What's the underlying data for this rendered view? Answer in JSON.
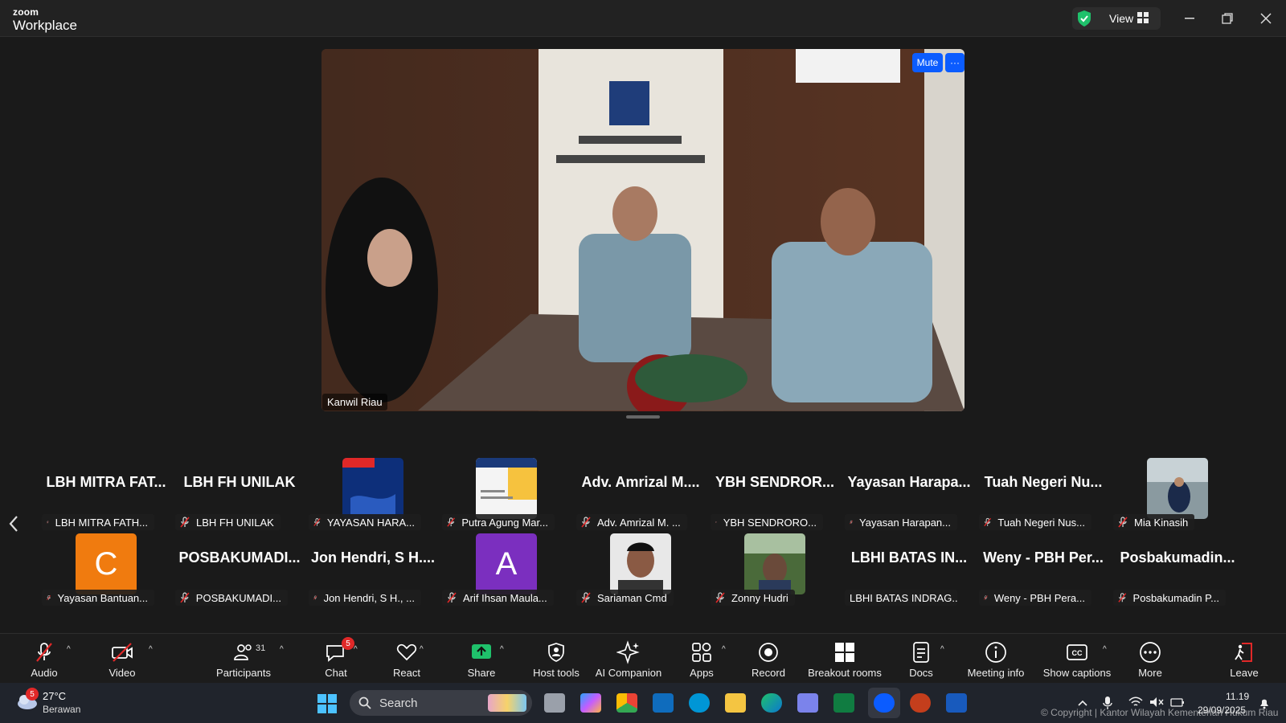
{
  "titlebar": {
    "brand_small": "zoom",
    "brand_big": "Workplace",
    "view_label": "View"
  },
  "meeting": {
    "speaker_name": "Kanwil Riau",
    "mute_label": "Mute",
    "more_label": "···"
  },
  "gallery": {
    "row1": [
      {
        "big": "LBH MITRA FAT...",
        "label": "LBH MITRA FATH..."
      },
      {
        "big": "LBH FH UNILAK",
        "label": "LBH FH UNILAK"
      },
      {
        "big": "",
        "label": "YAYASAN HARA...",
        "thumb": "pkpa-poster"
      },
      {
        "big": "",
        "label": "Putra Agung Mar...",
        "thumb": "document-slide"
      },
      {
        "big": "Adv. Amrizal M....",
        "label": "Adv. Amrizal M. ..."
      },
      {
        "big": "YBH SENDROR...",
        "label": "YBH SENDRORO..."
      },
      {
        "big": "Yayasan Harapa...",
        "label": "Yayasan Harapan..."
      },
      {
        "big": "Tuah Negeri Nu...",
        "label": "Tuah Negeri Nus..."
      },
      {
        "big": "",
        "label": "Mia Kinasih",
        "thumb": "camera-photo"
      }
    ],
    "row2": [
      {
        "big": "",
        "label": "Yayasan Bantuan...",
        "letter": "C",
        "color": "#f07b0f"
      },
      {
        "big": "POSBAKUMADI...",
        "label": "POSBAKUMADI..."
      },
      {
        "big": "Jon Hendri, S H....",
        "label": "Jon Hendri, S H., ..."
      },
      {
        "big": "",
        "label": "Arif Ihsan Maula...",
        "letter": "A",
        "color": "#7b2fbf"
      },
      {
        "big": "",
        "label": "Sariaman Cmd",
        "thumb": "face-photo"
      },
      {
        "big": "",
        "label": "Zonny Hudri",
        "thumb": "outdoor-photo"
      },
      {
        "big": "LBHI BATAS IN...",
        "label": "LBHI BATAS INDRAG...",
        "no_mic": true
      },
      {
        "big": "Weny - PBH Per...",
        "label": "Weny - PBH Pera..."
      },
      {
        "big": "Posbakumadin...",
        "label": "Posbakumadin P..."
      }
    ]
  },
  "toolbar": {
    "audio": "Audio",
    "video": "Video",
    "participants": "Participants",
    "participants_count": "31",
    "chat": "Chat",
    "chat_badge": "5",
    "react": "React",
    "share": "Share",
    "host_tools": "Host tools",
    "ai_companion": "AI Companion",
    "apps": "Apps",
    "record": "Record",
    "breakout_rooms": "Breakout rooms",
    "docs": "Docs",
    "meeting_info": "Meeting info",
    "show_captions": "Show captions",
    "more": "More",
    "leave": "Leave"
  },
  "taskbar": {
    "weather_badge": "5",
    "temperature": "27°C",
    "condition": "Berawan",
    "search_label": "Search",
    "time": "11.19",
    "date": "29/09/2025"
  },
  "watermark": "© Copyright | Kantor Wilayah Kementerian Hukum Riau",
  "colors": {
    "accent": "#0b5cff",
    "share_green": "#1fc16b",
    "leave_red": "#e02828",
    "badge_red": "#e02828"
  }
}
